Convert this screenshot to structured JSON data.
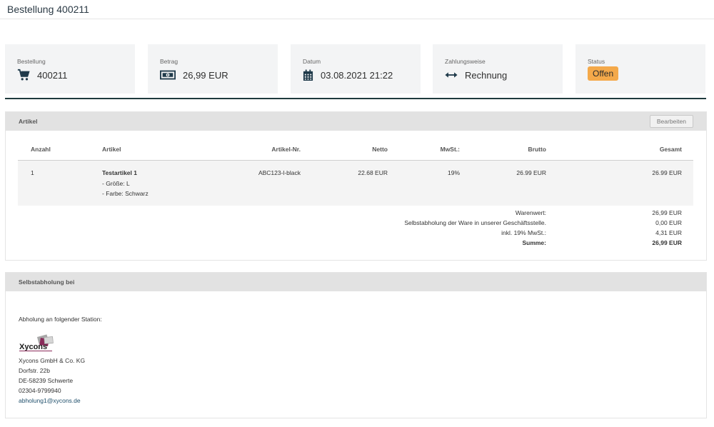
{
  "header": {
    "title": "Bestellung 400211"
  },
  "stats": {
    "order": {
      "label": "Bestellung",
      "value": "400211",
      "icon": "cart-icon"
    },
    "amount": {
      "label": "Betrag",
      "value": "26,99 EUR",
      "icon": "money-icon"
    },
    "date": {
      "label": "Datum",
      "value": "03.08.2021 21:22",
      "icon": "calendar-icon"
    },
    "payment": {
      "label": "Zahlungsweise",
      "value": "Rechnung",
      "icon": "arrows-horizontal-icon"
    },
    "status": {
      "label": "Status",
      "value": "Offen",
      "color": "#f4a94a"
    }
  },
  "items_panel": {
    "title": "Artikel",
    "edit_label": "Bearbeiten",
    "columns": [
      "Anzahl",
      "Artikel",
      "Artikel-Nr.",
      "Netto",
      "MwSt.:",
      "Brutto",
      "Gesamt"
    ],
    "rows": [
      {
        "qty": "1",
        "name": "Testartikel 1",
        "option1": "- Größe: L",
        "option2": "- Farbe: Schwarz",
        "sku": "ABC123-l-black",
        "net": "22.68 EUR",
        "vat": "19%",
        "gross": "26.99 EUR",
        "total": "26.99 EUR"
      }
    ],
    "summary": [
      {
        "label": "Warenwert:",
        "value": "26,99 EUR"
      },
      {
        "label": "Selbstabholung der Ware in unserer Geschäftsstelle.",
        "value": "0,00 EUR"
      },
      {
        "label": "inkl. 19% MwSt.:",
        "value": "4,31 EUR"
      },
      {
        "label": "Summe:",
        "value": "26,99 EUR"
      }
    ]
  },
  "pickup_panel": {
    "title": "Selbstabholung bei",
    "intro": "Abholung an folgender Station:",
    "logo_text": "Xycons",
    "company": "Xycons GmbH & Co. KG",
    "street": "Dorfstr. 22b",
    "city": "DE-58239 Schwerte",
    "phone": "02304-9799940",
    "email": "abholung1@xycons.de"
  }
}
